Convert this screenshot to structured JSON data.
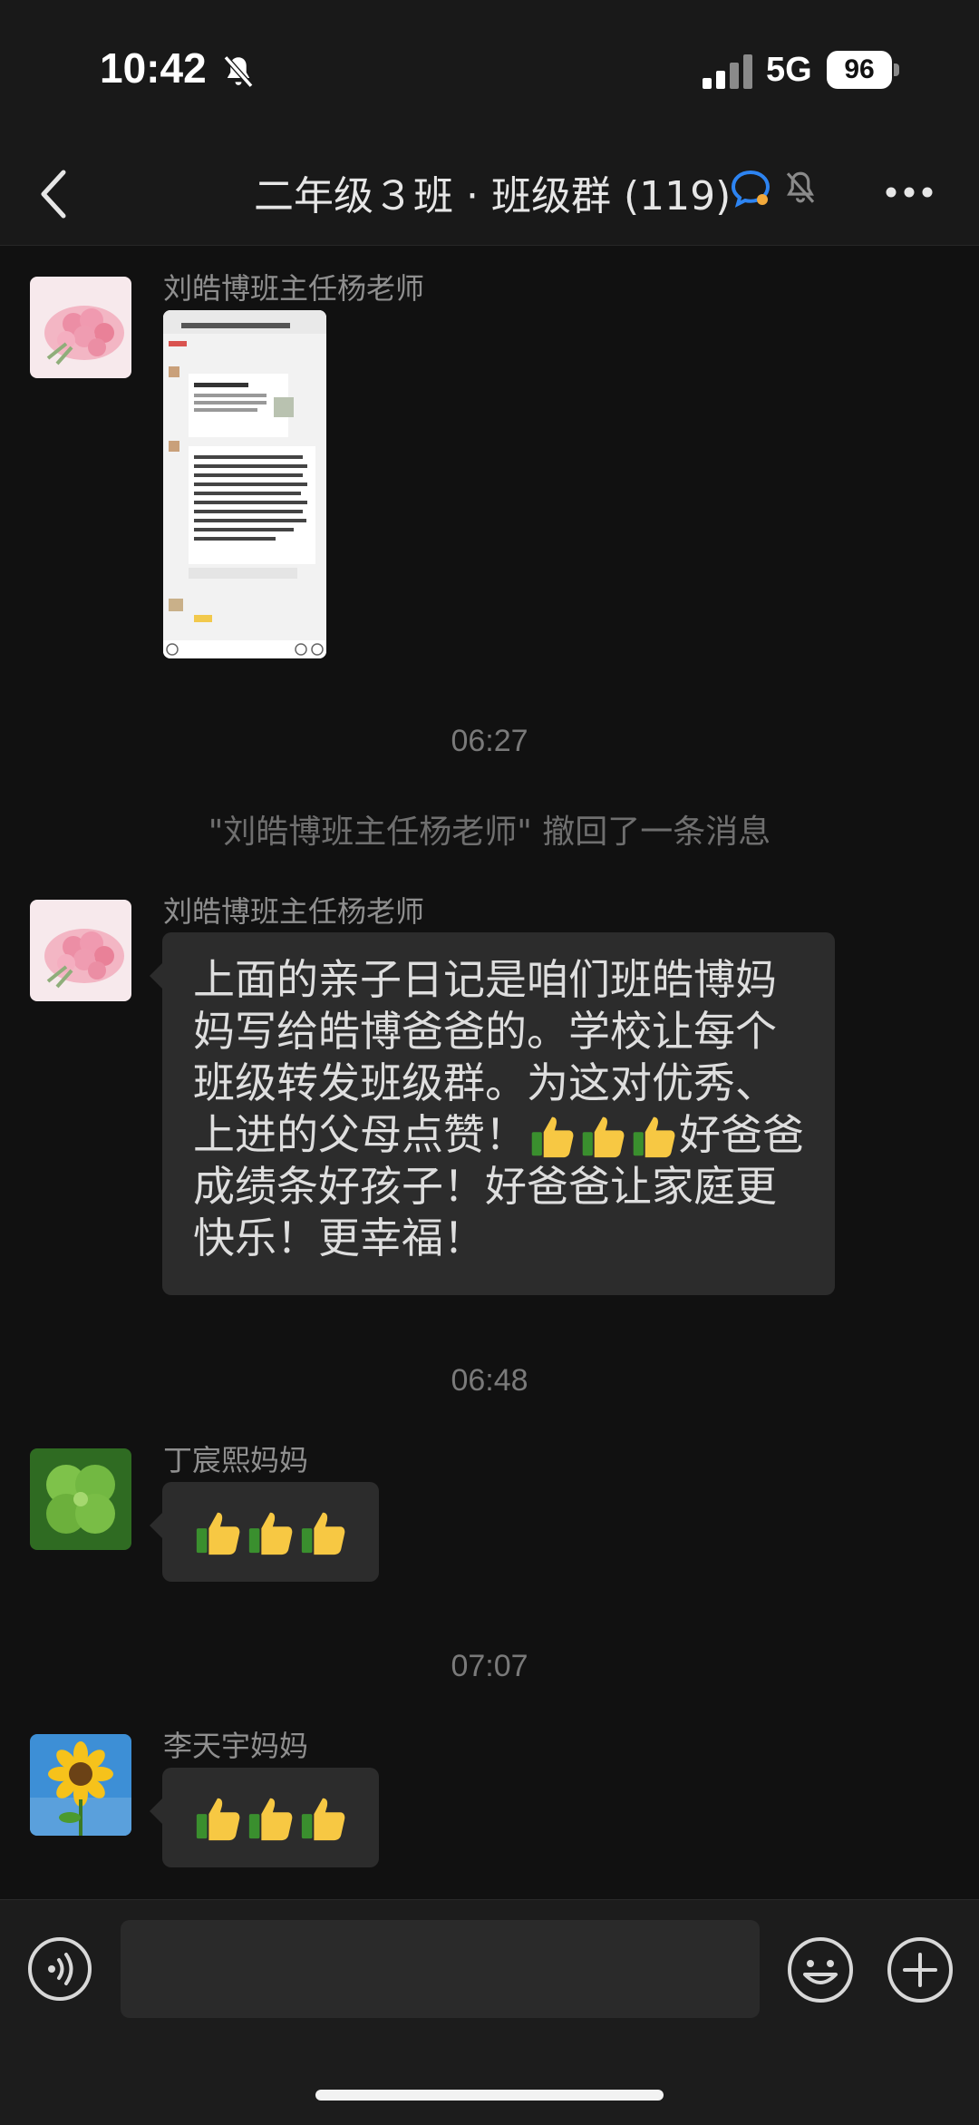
{
  "status_bar": {
    "time": "10:42",
    "network": "5G",
    "battery": "96"
  },
  "nav": {
    "title": "二年级３班 · 班级群 (119)"
  },
  "messages": [
    {
      "type": "image",
      "sender": "刘皓博班主任杨老师",
      "avatar": "pink-roses"
    },
    {
      "type": "timestamp",
      "text": "06:27"
    },
    {
      "type": "system",
      "text": "\"刘皓博班主任杨老师\" 撤回了一条消息"
    },
    {
      "type": "text",
      "sender": "刘皓博班主任杨老师",
      "avatar": "pink-roses",
      "lines": [
        "上面的亲子日记是咱们班皓博妈",
        "妈写给皓博爸爸的。学校让每个",
        "班级转发班级群。为这对优秀、",
        "上进的父母点赞！",
        "好爸爸",
        "成绩条好孩子！好爸爸让家庭更",
        "快乐！更幸福！"
      ]
    },
    {
      "type": "timestamp",
      "text": "06:48"
    },
    {
      "type": "emoji",
      "sender": "丁宸熙妈妈",
      "avatar": "clover",
      "count": 3
    },
    {
      "type": "timestamp",
      "text": "07:07"
    },
    {
      "type": "emoji",
      "sender": "李天宇妈妈",
      "avatar": "sunflower",
      "count": 3
    }
  ],
  "icons": {
    "back": "back-chevron-icon",
    "mute": "bell-off-icon",
    "more": "more-icon",
    "voice": "voice-icon",
    "emoji": "emoji-icon",
    "plus": "plus-icon",
    "thumbs_up": "thumbs-up-icon"
  },
  "colors": {
    "background": "#111111",
    "bar": "#191919",
    "bubble": "#2c2c2c",
    "accent": "#2d84f2"
  }
}
